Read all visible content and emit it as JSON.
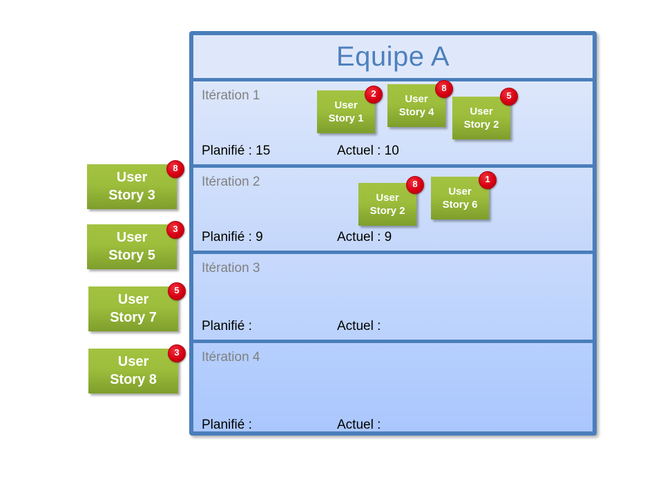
{
  "board": {
    "title": "Equipe A",
    "accent_border": "#4a7ebb",
    "title_color": "#4e80bd",
    "iterations": [
      {
        "label": "Itération 1",
        "planned": "Planifié : 15",
        "actual": "Actuel : 10",
        "stories": [
          {
            "line1": "User",
            "line2": "Story 1",
            "points": "2"
          },
          {
            "line1": "User",
            "line2": "Story 4",
            "points": "8"
          },
          {
            "line1": "User",
            "line2": "Story 2",
            "points": "5"
          }
        ]
      },
      {
        "label": "Itération 2",
        "planned": "Planifié : 9",
        "actual": "Actuel : 9",
        "stories": [
          {
            "line1": "User",
            "line2": "Story 2",
            "points": "8"
          },
          {
            "line1": "User",
            "line2": "Story 6",
            "points": "1"
          }
        ]
      },
      {
        "label": "Itération 3",
        "planned": "Planifié :",
        "actual": "Actuel :",
        "stories": []
      },
      {
        "label": "Itération 4",
        "planned": "Planifié :",
        "actual": "Actuel :",
        "stories": []
      }
    ]
  },
  "backlog": {
    "stories": [
      {
        "line1": "User",
        "line2": "Story 3",
        "points": "8"
      },
      {
        "line1": "User",
        "line2": "Story 5",
        "points": "3"
      },
      {
        "line1": "User",
        "line2": "Story 7",
        "points": "5"
      },
      {
        "line1": "User",
        "line2": "Story 8",
        "points": "3"
      }
    ]
  },
  "colors": {
    "card_green_light": "#a2c240",
    "card_green_dark": "#7e9e2c",
    "badge_red": "#d80013",
    "panel_blue": "#cddffa",
    "border_blue": "#4a7ebb"
  }
}
